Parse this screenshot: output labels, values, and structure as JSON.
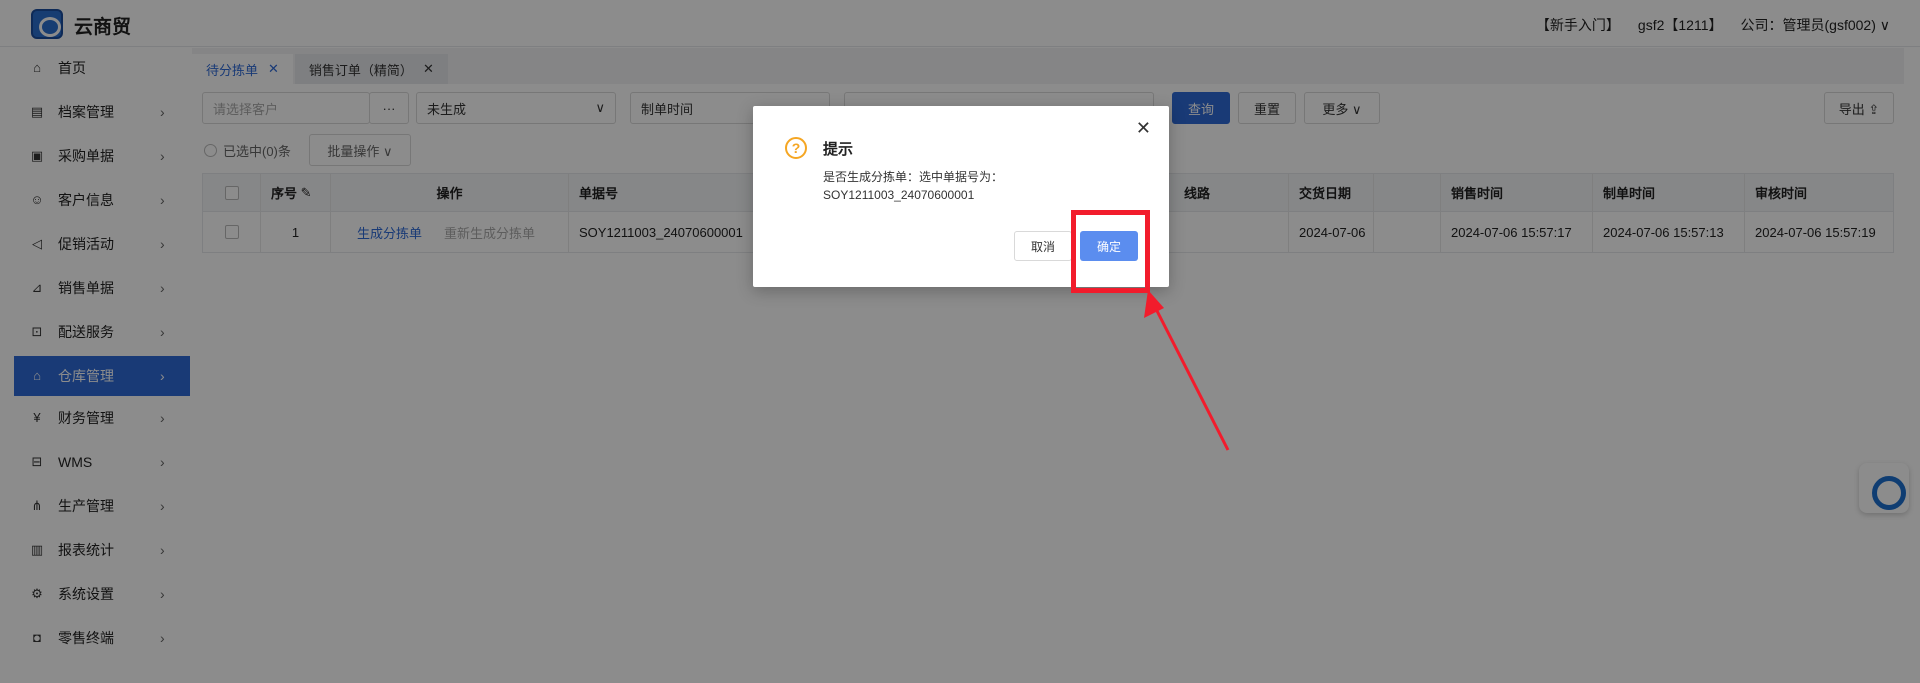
{
  "header": {
    "brand": "云商贸",
    "guide": "【新手入门】",
    "user": "gsf2【1211】",
    "company": "公司：管理员(gsf002) ∨"
  },
  "sidebar": {
    "items": [
      {
        "label": "首页",
        "icon": "home-icon",
        "glyph": "⌂"
      },
      {
        "label": "档案管理",
        "icon": "archive-icon",
        "glyph": "▤"
      },
      {
        "label": "采购单据",
        "icon": "purchase-icon",
        "glyph": "▣"
      },
      {
        "label": "客户信息",
        "icon": "user-icon",
        "glyph": "☺"
      },
      {
        "label": "促销活动",
        "icon": "megaphone-icon",
        "glyph": "◁"
      },
      {
        "label": "销售单据",
        "icon": "chart-line-icon",
        "glyph": "⊿"
      },
      {
        "label": "配送服务",
        "icon": "cart-icon",
        "glyph": "⊡"
      },
      {
        "label": "仓库管理",
        "icon": "warehouse-icon",
        "glyph": "⌂"
      },
      {
        "label": "财务管理",
        "icon": "finance-icon",
        "glyph": "¥"
      },
      {
        "label": "WMS",
        "icon": "truck-icon",
        "glyph": "⊟"
      },
      {
        "label": "生产管理",
        "icon": "production-icon",
        "glyph": "⋔"
      },
      {
        "label": "报表统计",
        "icon": "bar-chart-icon",
        "glyph": "▥"
      },
      {
        "label": "系统设置",
        "icon": "gear-icon",
        "glyph": "⚙"
      },
      {
        "label": "零售终端",
        "icon": "bag-icon",
        "glyph": "◘"
      }
    ],
    "chevron": "›"
  },
  "tabs": [
    {
      "label": "待分拣单",
      "close": "✕"
    },
    {
      "label": "销售订单（精简）",
      "close": "✕"
    }
  ],
  "filters": {
    "customer_placeholder": "请选择客户",
    "ellipsis": "···",
    "status": "未生成",
    "status_arrow": "∨",
    "time_label": "制单时间",
    "query": "查询",
    "reset": "重置",
    "more": "更多 ∨",
    "export": "导出 ⇪",
    "selected": "已选中(0)条",
    "batch": "批量操作 ∨"
  },
  "table": {
    "headers": [
      "序号",
      "操作",
      "单据号",
      "线路",
      "交货日期",
      "销售时间",
      "制单时间",
      "审核时间"
    ],
    "rows": [
      {
        "index": "1",
        "action1": "生成分拣单",
        "action2": "重新生成分拣单",
        "doc_no": "SOY1211003_24070600001",
        "route": "",
        "delivery_date": "2024-07-06",
        "sale_time": "2024-07-06 15:57:17",
        "create_time": "2024-07-06 15:57:13",
        "audit_time": "2024-07-06 15:57:19"
      }
    ]
  },
  "modal": {
    "title": "提示",
    "warn_glyph": "?",
    "message_line1": "是否生成分拣单：选中单据号为：",
    "message_line2": "SOY1211003_24070600001",
    "close": "✕",
    "cancel": "取消",
    "ok": "确定"
  },
  "colors": {
    "primary": "#2f6bd8",
    "highlight": "#f21c2c",
    "warning": "#f5a623"
  }
}
